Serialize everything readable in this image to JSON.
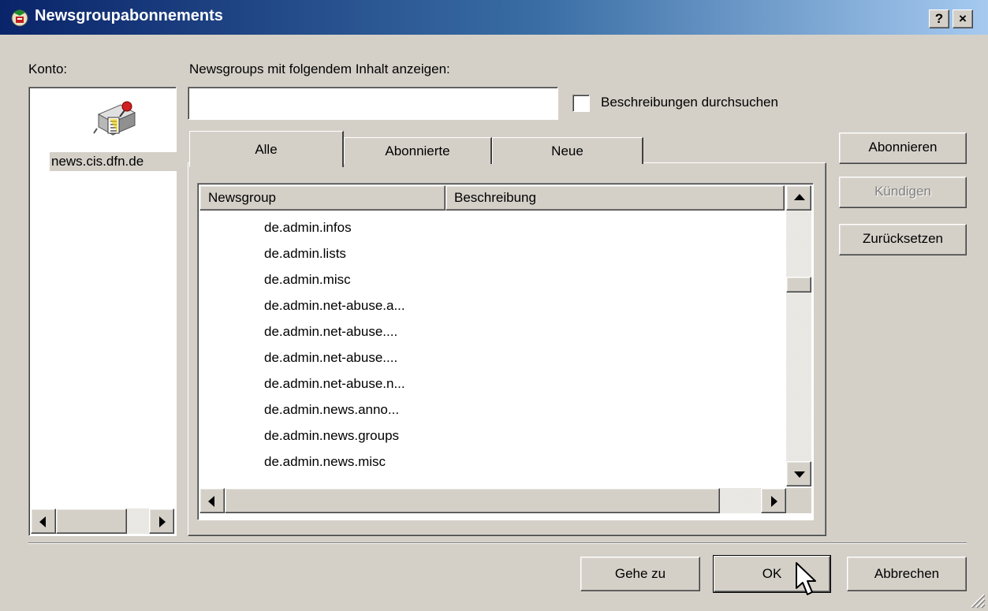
{
  "window": {
    "title": "Newsgroupabonnements",
    "help_button": "?",
    "close_button": "×"
  },
  "account": {
    "label": "Konto:",
    "server": "news.cis.dfn.de"
  },
  "filter": {
    "label": "Newsgroups mit folgendem Inhalt anzeigen:",
    "value": "",
    "search_descriptions_label": "Beschreibungen durchsuchen",
    "search_descriptions_checked": false
  },
  "tabs": [
    {
      "label": "Alle",
      "active": true
    },
    {
      "label": "Abonnierte",
      "active": false
    },
    {
      "label": "Neue",
      "active": false
    }
  ],
  "list": {
    "columns": [
      "Newsgroup",
      "Beschreibung"
    ],
    "rows": [
      "de.admin.infos",
      "de.admin.lists",
      "de.admin.misc",
      "de.admin.net-abuse.a...",
      "de.admin.net-abuse....",
      "de.admin.net-abuse....",
      "de.admin.net-abuse.n...",
      "de.admin.news.anno...",
      "de.admin.news.groups",
      "de.admin.news.misc"
    ]
  },
  "side_buttons": {
    "subscribe": "Abonnieren",
    "unsubscribe": "Kündigen",
    "reset": "Zurücksetzen"
  },
  "footer_buttons": {
    "goto": "Gehe zu",
    "ok": "OK",
    "cancel": "Abbrechen"
  },
  "icons": {
    "app": "newsgroup-app-icon",
    "server": "news-server-icon",
    "cursor": "mouse-pointer-icon"
  }
}
